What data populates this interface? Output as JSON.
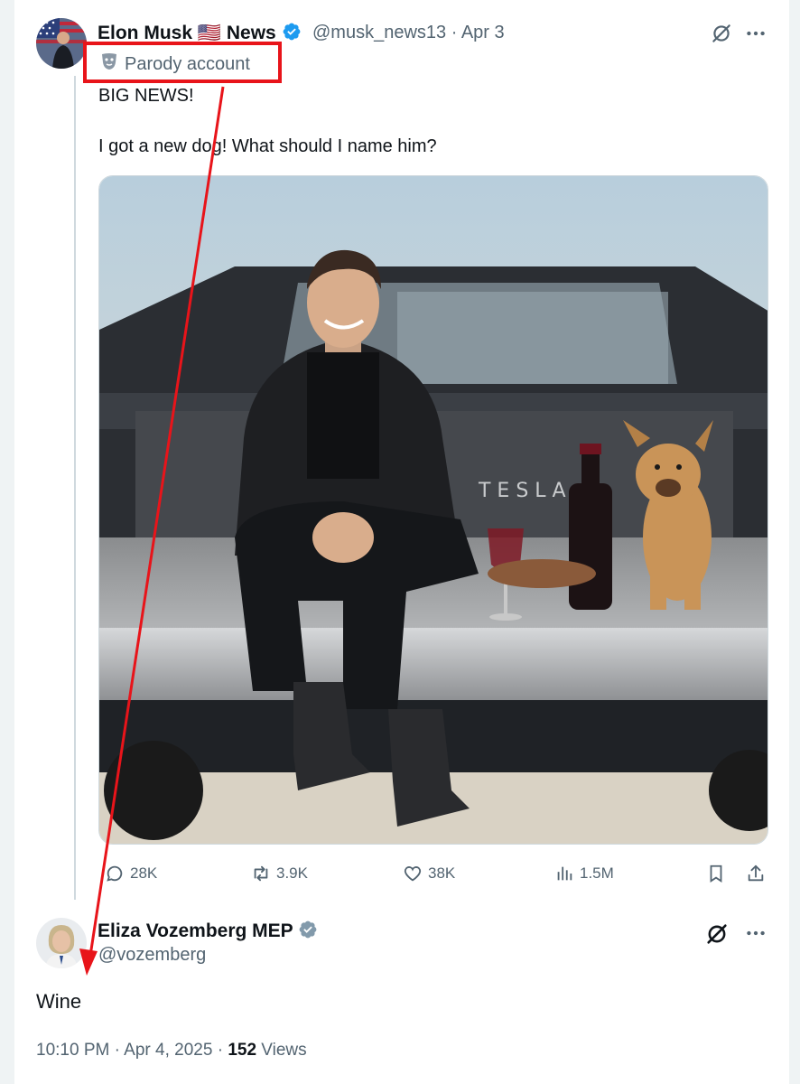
{
  "tweet": {
    "author_name_1": "Elon Musk",
    "author_flag": "🇺🇸",
    "author_name_2": "News",
    "handle": "@musk_news13",
    "sep": "·",
    "date": "Apr 3",
    "parody_label": "Parody account",
    "text_line1": "BIG NEWS!",
    "text_line2": "I got a new dog! What should I name him?",
    "image_tailgate_text": "T E S L A",
    "stats": {
      "replies": "28K",
      "reposts": "3.9K",
      "likes": "38K",
      "views": "1.5M"
    },
    "verified_color": "#1d9bf0"
  },
  "reply": {
    "author_name": "Eliza Vozemberg MEP",
    "handle": "@vozemberg",
    "text": "Wine",
    "time": "10:10 PM",
    "sep": "·",
    "date": "Apr 4, 2025",
    "views_count": "152",
    "views_label": "Views",
    "verified_color": "#829aab"
  },
  "annotation": {
    "color": "#e8141a"
  }
}
